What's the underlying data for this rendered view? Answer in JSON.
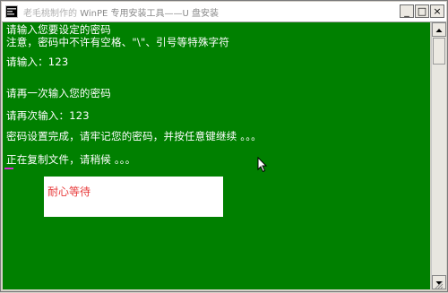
{
  "window": {
    "title_prefix": "老毛桃制作的 ",
    "title_main": "WinPE 专用安装工具——U 盘安装",
    "buttons": {
      "minimize": "_",
      "maximize": "□",
      "close": "×"
    }
  },
  "console": {
    "lines": [
      "请输入您要设定的密码",
      "注意，密码中不许有空格、\"\\\"、引号等特殊字符",
      "请输入：123",
      "请再一次输入您的密码",
      "请再次输入：123",
      "密码设置完成，请牢记您的密码，并按任意键继续 。。。",
      "正在复制文件，请稍候 。。。"
    ],
    "background_color": "#008000",
    "text_color": "#ffffff"
  },
  "wait_popup": {
    "text": "耐心等待",
    "text_color": "#e83a3a"
  }
}
